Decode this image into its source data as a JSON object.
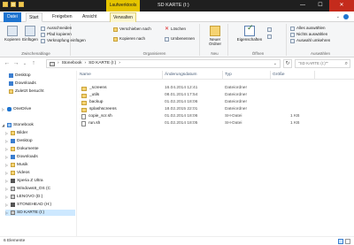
{
  "window": {
    "title": "SD KARTE (I:)",
    "context_tab_header": "Laufwerktools",
    "controls": {
      "minimize": "—",
      "maximize": "☐",
      "close": "✕"
    }
  },
  "ribbon_tabs": [
    {
      "label": "Datei"
    },
    {
      "label": "Start"
    },
    {
      "label": "Freigeben"
    },
    {
      "label": "Ansicht"
    },
    {
      "label": "Verwalten"
    }
  ],
  "ribbon": {
    "clipboard": {
      "copy": "Kopieren",
      "paste": "Einfügen",
      "cut": "Ausschneiden",
      "copy_path": "Pfad kopieren",
      "paste_shortcut": "Verknüpfung einfügen",
      "label": "Zwischenablage"
    },
    "organize": {
      "move_to": "Verschieben nach",
      "copy_to": "Kopieren nach",
      "delete": "Löschen",
      "rename": "Umbenennen",
      "label": "Organisieren"
    },
    "new": {
      "new_folder": "Neuer Ordner",
      "label": "Neu"
    },
    "open": {
      "properties": "Eigenschaften",
      "label": "Öffnen"
    },
    "select": {
      "select_all": "Alles auswählen",
      "select_none": "Nichts auswählen",
      "invert": "Auswahl umkehren",
      "label": "Auswählen"
    }
  },
  "address": {
    "path": [
      "Stonebook",
      "SD KARTE (I:)"
    ],
    "search_placeholder": "\"SD KARTE (I:)\"\""
  },
  "nav_pane": [
    {
      "label": "Desktop",
      "icon": "desktop-icon"
    },
    {
      "label": "Downloads",
      "icon": "downloads-icon"
    },
    {
      "label": "Zuletzt besucht",
      "icon": "recent-icon"
    },
    {
      "label": "OneDrive",
      "icon": "onedrive-icon"
    },
    {
      "label": "Stonebook",
      "icon": "computer-icon"
    },
    {
      "label": "Bilder",
      "icon": "folder-icon"
    },
    {
      "label": "Desktop",
      "icon": "folder-icon"
    },
    {
      "label": "Dokumente",
      "icon": "folder-icon"
    },
    {
      "label": "Downloads",
      "icon": "folder-icon"
    },
    {
      "label": "Musik",
      "icon": "folder-icon"
    },
    {
      "label": "Videos",
      "icon": "folder-icon"
    },
    {
      "label": "Xperia Z Ultra",
      "icon": "phone-icon"
    },
    {
      "label": "Windows8_OS (C",
      "icon": "drive-icon"
    },
    {
      "label": "LENOVO (D:)",
      "icon": "drive-icon"
    },
    {
      "label": "STONEHEAD (H:)",
      "icon": "usb-icon"
    },
    {
      "label": "SD KARTE (I:)",
      "icon": "sdcard-icon"
    }
  ],
  "columns": [
    "Name",
    "Änderungsdatum",
    "Typ",
    "Größe"
  ],
  "files": [
    {
      "name": "_screens",
      "date": "16.04.2014 12:41",
      "type": "Dateiordner",
      "size": "",
      "icon": "folder-icon"
    },
    {
      "name": "_utils",
      "date": "08.01.2014 17:54",
      "type": "Dateiordner",
      "size": "",
      "icon": "folder-icon"
    },
    {
      "name": "backup",
      "date": "01.02.2014 18:06",
      "type": "Dateiordner",
      "size": "",
      "icon": "folder-icon"
    },
    {
      "name": "splashscreens",
      "date": "18.02.2015 22:01",
      "type": "Dateiordner",
      "size": "",
      "icon": "folder-icon"
    },
    {
      "name": "copie_scr.sh",
      "date": "01.02.2014 18:06",
      "type": "SH-Datei",
      "size": "1 KB",
      "icon": "file-icon"
    },
    {
      "name": "run.sh",
      "date": "01.02.2014 18:05",
      "type": "SH-Datei",
      "size": "1 KB",
      "icon": "file-icon"
    }
  ],
  "status": {
    "count": "6 Elemente"
  },
  "colors": {
    "file_tab": "#1e74d0",
    "context_tab": "#e5c400",
    "close": "#c42b1c",
    "selection": "#cde8ff"
  }
}
